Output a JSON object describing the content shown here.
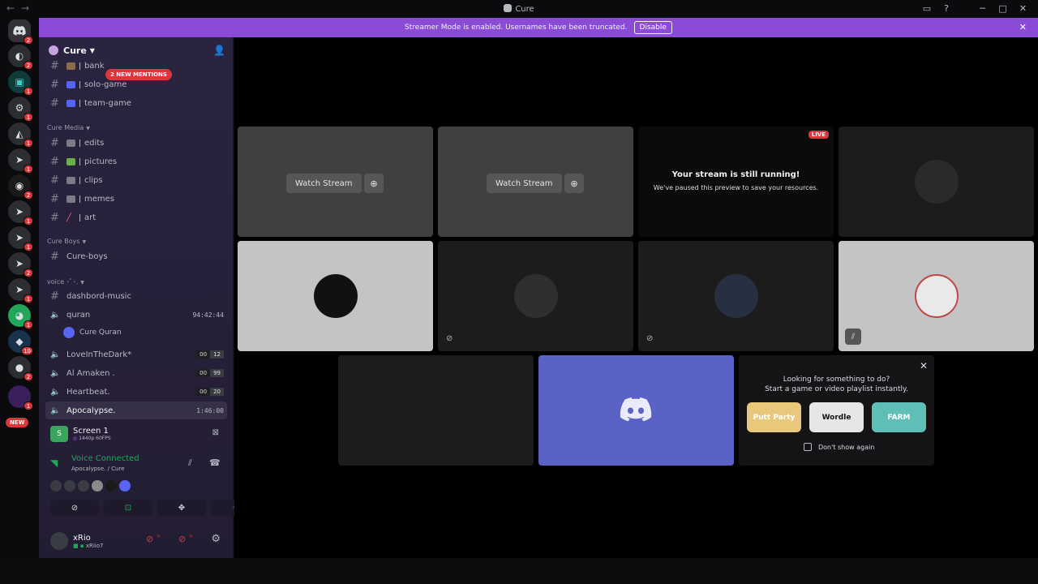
{
  "window": {
    "title": "Cure",
    "back_glyph": "←",
    "forward_glyph": "→"
  },
  "banner": {
    "message": "Streamer Mode is enabled. Usernames have been truncated.",
    "disable_label": "Disable"
  },
  "guilds": {
    "badges": [
      "2",
      "2",
      "1",
      "1",
      "1",
      "1",
      "2",
      "1",
      "1",
      "2",
      "1",
      "1",
      "10",
      "2",
      "1"
    ],
    "new_label": "NEW"
  },
  "server": {
    "name": "Cure",
    "new_mentions": "2 NEW MENTIONS"
  },
  "channels": {
    "top": [
      {
        "name": "bank"
      },
      {
        "name": "solo-game"
      },
      {
        "name": "team-game"
      }
    ],
    "cure_media_label": "Cure Media",
    "cure_media": [
      {
        "name": "edits"
      },
      {
        "name": "pictures"
      },
      {
        "name": "clips"
      },
      {
        "name": "memes"
      },
      {
        "name": "art"
      }
    ],
    "cure_boys_label": "Cure Boys",
    "cure_boys": [
      {
        "name": "Cure-boys"
      }
    ],
    "voice_label": "voice ･ﾟ･.",
    "voice": [
      {
        "name": "dashbord-music",
        "type": "text"
      },
      {
        "name": "quran",
        "type": "voice",
        "timer": "94:42:44"
      },
      {
        "name": "LoveInTheDark*",
        "type": "voice",
        "count_a": "00",
        "count_b": "12"
      },
      {
        "name": "Al Amaken .",
        "type": "voice",
        "count_a": "00",
        "count_b": "99"
      },
      {
        "name": "Heartbeat.",
        "type": "voice",
        "count_a": "00",
        "count_b": "20"
      },
      {
        "name": "Apocalypse.",
        "type": "voice",
        "timer": "1:46:00"
      }
    ],
    "quran_member": "Cure Quran"
  },
  "screen_share": {
    "title": "Screen 1",
    "quality": "1440p 60FPS"
  },
  "voice_connection": {
    "status": "Voice Connected",
    "location": "Apocalypse. / Cure"
  },
  "user": {
    "name": "xRio",
    "tag": "xRiio7"
  },
  "stage": {
    "watch_label": "Watch Stream",
    "live_label": "LIVE",
    "paused_title": "Your stream is still running!",
    "paused_desc": "We've paused this preview to save your resources.",
    "activity_title_1": "Looking for something to do?",
    "activity_title_2": "Start a game or video playlist instantly.",
    "games": [
      "Putt Party",
      "Wordle",
      "FARM"
    ],
    "dont_show": "Don't show again"
  },
  "colors": {
    "banner": "#8b4bd7",
    "accent_green": "#23a55a",
    "alert_red": "#da373c",
    "blurple": "#5865f2"
  }
}
